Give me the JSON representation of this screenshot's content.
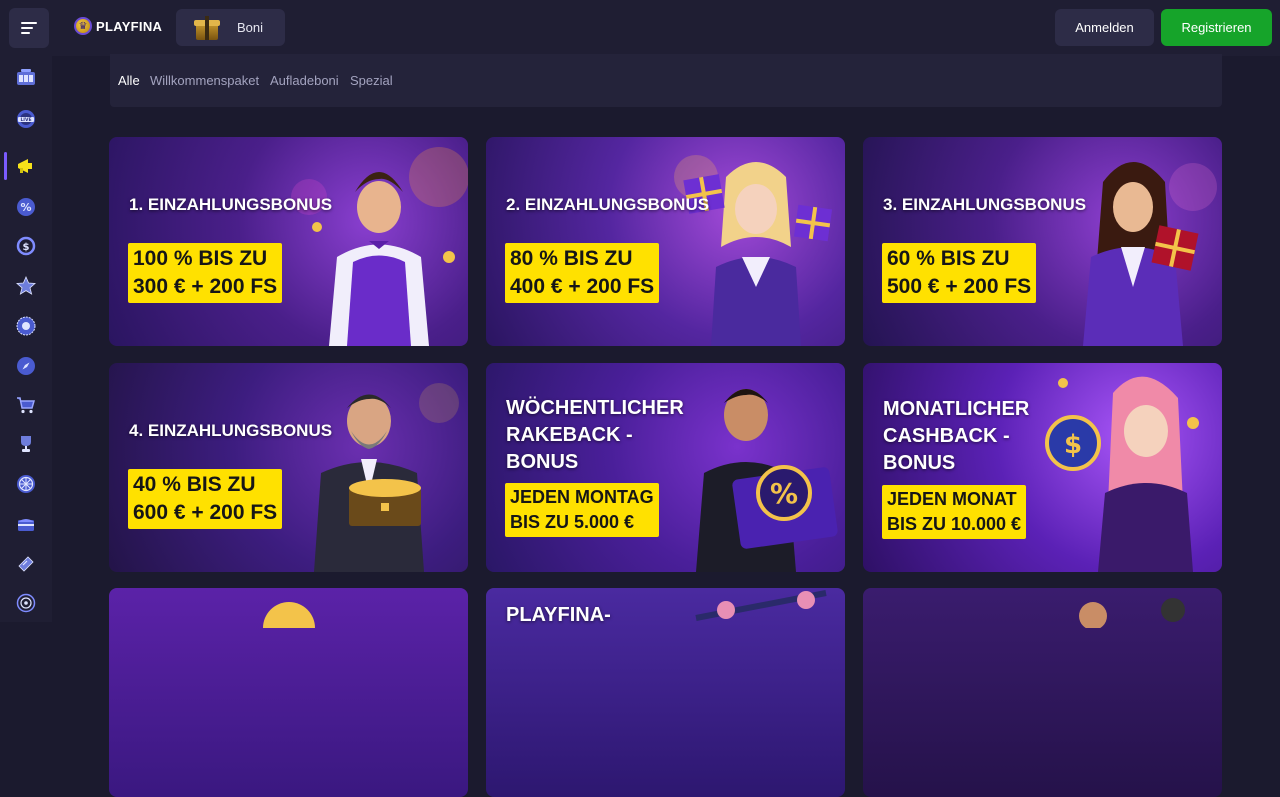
{
  "header": {
    "brand": "PLAYFINA",
    "bonus_label": "Boni",
    "login_label": "Anmelden",
    "register_label": "Registrieren",
    "register_color": "#16a42a"
  },
  "sidebar": {
    "items": [
      {
        "name": "slots-icon"
      },
      {
        "name": "live-casino-icon"
      },
      {
        "name": "megaphone-icon",
        "active": true
      },
      {
        "name": "percent-icon"
      },
      {
        "name": "cashback-icon"
      },
      {
        "name": "star-icon"
      },
      {
        "name": "vip-badge-icon"
      },
      {
        "name": "compass-icon"
      },
      {
        "name": "shop-cart-icon"
      },
      {
        "name": "trophy-icon"
      },
      {
        "name": "wheel-icon"
      },
      {
        "name": "chest-icon"
      },
      {
        "name": "ticket-icon"
      },
      {
        "name": "target-icon"
      }
    ]
  },
  "filters": {
    "tabs": [
      "Alle",
      "Willkommenspaket",
      "Aufladeboni",
      "Spezial"
    ],
    "active": "Alle"
  },
  "cards": [
    {
      "title": "1. EINZAHLUNGSBONUS",
      "tag": [
        "100 % BIS ZU",
        "300 € + 200 FS"
      ]
    },
    {
      "title": "2. EINZAHLUNGSBONUS",
      "tag": [
        "80 % BIS ZU",
        "400 € + 200 FS"
      ]
    },
    {
      "title": "3. EINZAHLUNGSBONUS",
      "tag": [
        "60 % BIS ZU",
        "500 € + 200 FS"
      ]
    },
    {
      "title": "4. EINZAHLUNGSBONUS",
      "tag": [
        "40 % BIS ZU",
        "600 € + 200 FS"
      ]
    },
    {
      "title": [
        "WÖCHENTLICHER",
        "RAKEBACK -",
        "BONUS"
      ],
      "tag": [
        "JEDEN MONTAG",
        "BIS ZU 5.000 €"
      ]
    },
    {
      "title": [
        "MONATLICHER",
        "CASHBACK -",
        "BONUS"
      ],
      "tag": [
        "JEDEN MONAT",
        "BIS ZU 10.000 €"
      ]
    },
    {
      "title": "",
      "tag": []
    },
    {
      "title": "PLAYFINA-",
      "tag": []
    },
    {
      "title": "",
      "tag": []
    }
  ],
  "colors": {
    "page_bg": "#1b1a2e",
    "panel_bg": "#1f1e33",
    "tag_yellow": "#ffe100",
    "accent_purple": "#7b5bff"
  }
}
